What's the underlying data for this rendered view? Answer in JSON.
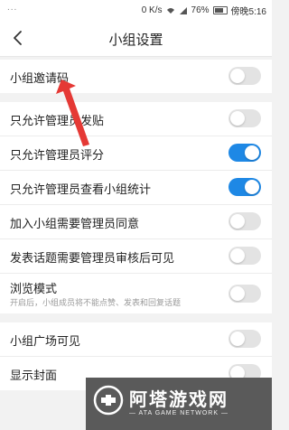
{
  "status_bar": {
    "dots": "...",
    "net_speed": "0 K/s",
    "battery_pct": "76%",
    "time": "傍晚5:16",
    "icons": [
      "wifi-icon",
      "signal-icon",
      "battery-icon"
    ]
  },
  "nav": {
    "back_icon": "chevron-left-icon",
    "title": "小组设置"
  },
  "settings": [
    {
      "label": "小组邀请码",
      "on": false
    },
    {
      "label": "只允许管理员发贴",
      "on": false
    },
    {
      "label": "只允许管理员评分",
      "on": true
    },
    {
      "label": "只允许管理员查看小组统计",
      "on": true
    },
    {
      "label": "加入小组需要管理员同意",
      "on": false
    },
    {
      "label": "发表话题需要管理员审核后可见",
      "on": false
    },
    {
      "label": "浏览模式",
      "sub": "开启后，小组成员将不能点赞、发表和回复话题",
      "on": false
    },
    {
      "label": "小组广场可见",
      "on": false
    },
    {
      "label": "显示封面",
      "on": false
    }
  ],
  "colors": {
    "toggle_on": "#1e88e5",
    "toggle_off": "#e3e3e3",
    "arrow": "#e53935"
  },
  "watermark": {
    "title": "阿塔游戏网",
    "subtitle": "— ATA GAME NETWORK —"
  }
}
